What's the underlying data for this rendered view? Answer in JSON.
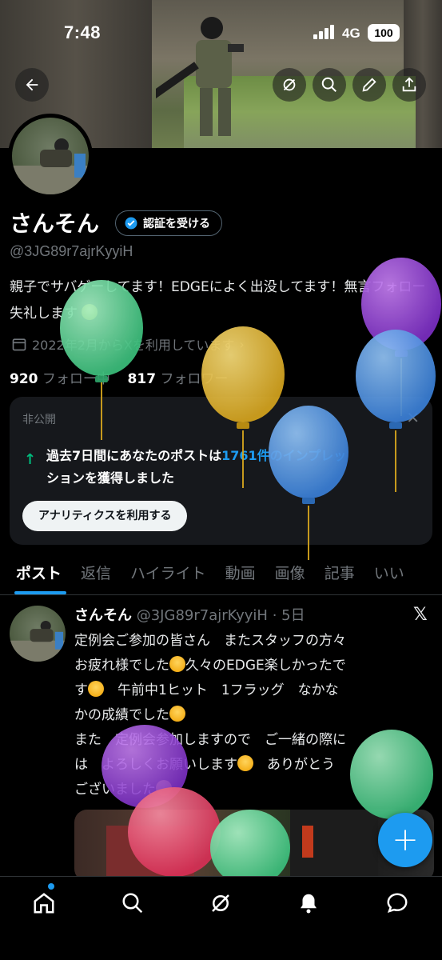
{
  "status": {
    "time": "7:48",
    "network": "4G",
    "battery": "100"
  },
  "profile": {
    "name": "さんそん",
    "verify_label": "認証を受ける",
    "handle": "@3JG89r7ajrKyyiH",
    "bio_line1": "親子でサバゲーしてます！EDGEによく出没してます！無言フォロー失礼します",
    "joined": "2022年2月からXを利用しています",
    "following_count": "920",
    "following_label": "フォロー中",
    "followers_count": "817",
    "followers_label": "フォロワー"
  },
  "analytics": {
    "private_label": "非公開",
    "text_before": "過去7日間にあなたのポストは",
    "highlight": "1761件のインプレッ",
    "text_after": "ションを獲得しました",
    "button": "アナリティクスを利用する"
  },
  "tabs": [
    "ポスト",
    "返信",
    "ハイライト",
    "動画",
    "画像",
    "記事",
    "いい"
  ],
  "post": {
    "name": "さんそん",
    "handle_time": "@3JG89r7ajrKyyiH · 5日",
    "line1": "定例会ご参加の皆さん　またスタッフの方々",
    "line2": "お疲れ様でした",
    "line2b": "久々のEDGE楽しかったで",
    "line3": "す",
    "line3b": "　午前中1ヒット　1フラッグ　なかな",
    "line4": "かの成績でした",
    "line5": "また　定例会参加しますので　ご一緒の際に",
    "line6": "は　よろしくお願いします",
    "line6b": "　ありがとう",
    "line7": "ございました"
  },
  "fab_label": "+",
  "nav": [
    "home-icon",
    "search-icon",
    "grok-icon",
    "notifications-icon",
    "messages-icon"
  ],
  "colors": {
    "accent": "#1d9bf0",
    "background": "#000000",
    "muted": "#71767b"
  }
}
